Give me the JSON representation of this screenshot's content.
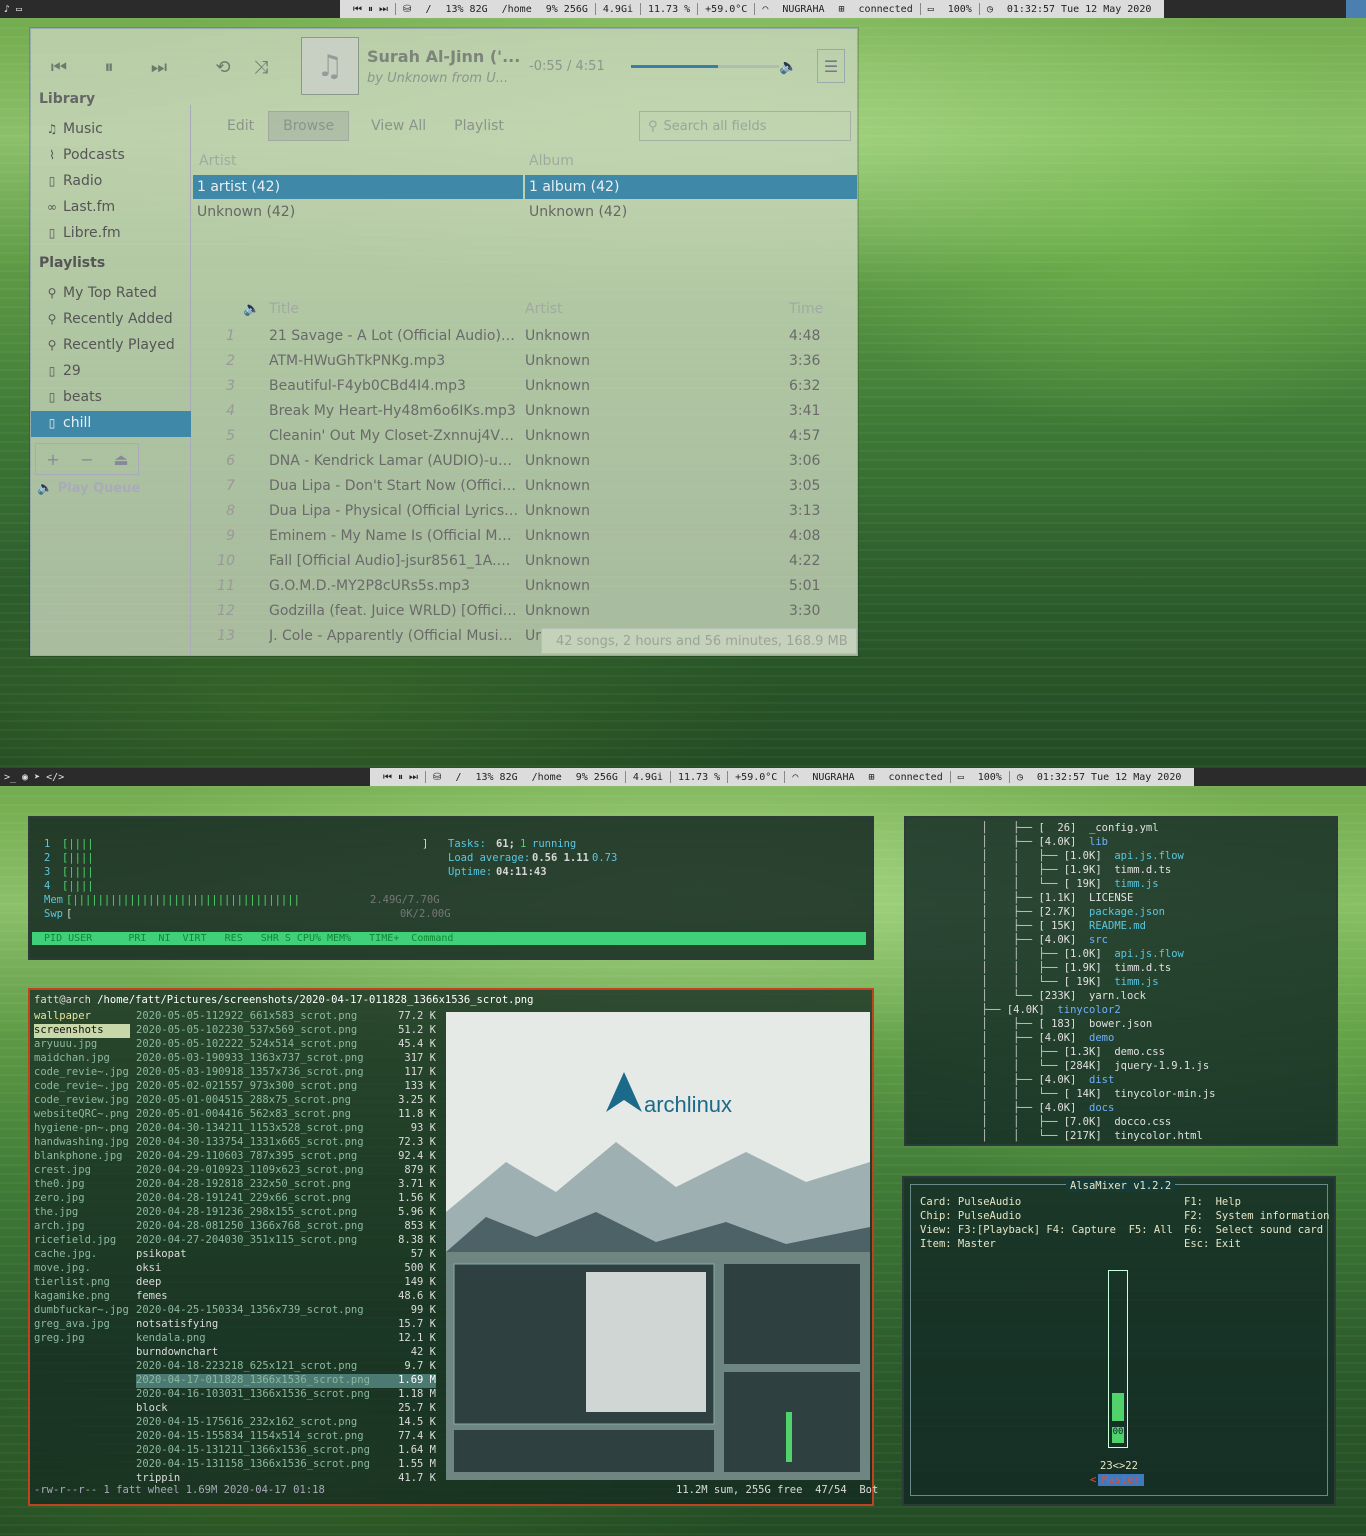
{
  "topbar": {
    "media": "⏮ ⏸ ⏭",
    "disk_root_label": "/",
    "disk_root": "13% 82G",
    "disk_home_label": "/home",
    "disk_home": "9% 256G",
    "mem": "4.9Gi",
    "cpu": "11.73 %",
    "temp": "+59.0°C",
    "wifi": "NUGRAHA",
    "net": "connected",
    "battery": "100%",
    "clock": "01:32:57 Tue 12 May 2020"
  },
  "clementine": {
    "now_playing": {
      "title": "Surah Al-Jinn ('...",
      "subtitle": "by Unknown from U...",
      "time": "-0:55 / 4:51",
      "progress": 0.59
    },
    "sidebar": {
      "library_heading": "Library",
      "library": [
        {
          "label": "Music",
          "icon": "music-icon"
        },
        {
          "label": "Podcasts",
          "icon": "rss-icon"
        },
        {
          "label": "Radio",
          "icon": "radio-icon"
        },
        {
          "label": "Last.fm",
          "icon": "lastfm-icon"
        },
        {
          "label": "Libre.fm",
          "icon": "radio-icon"
        }
      ],
      "playlists_heading": "Playlists",
      "playlists": [
        {
          "label": "My Top Rated",
          "icon": "search-icon"
        },
        {
          "label": "Recently Added",
          "icon": "search-icon"
        },
        {
          "label": "Recently Played",
          "icon": "search-icon"
        },
        {
          "label": "29",
          "icon": "file-icon"
        },
        {
          "label": "beats",
          "icon": "file-icon"
        },
        {
          "label": "chill",
          "icon": "file-icon"
        }
      ],
      "tools": [
        "+",
        "−",
        "⏏"
      ],
      "play_queue": "Play Queue"
    },
    "tabs": [
      "Edit",
      "Browse",
      "View All",
      "Playlist"
    ],
    "search_placeholder": "Search all fields",
    "artist_col": "Artist",
    "album_col": "Album",
    "artists": [
      "1 artist (42)",
      "Unknown (42)"
    ],
    "albums": [
      "1 album (42)",
      "Unknown (42)"
    ],
    "track_headers": {
      "title": "Title",
      "artist": "Artist",
      "time": "Time"
    },
    "tracks": [
      {
        "n": "1",
        "title": "21 Savage - A Lot (Official Audio)-Vb...",
        "artist": "Unknown",
        "time": "4:48"
      },
      {
        "n": "2",
        "title": "ATM-HWuGhTkPNKg.mp3",
        "artist": "Unknown",
        "time": "3:36"
      },
      {
        "n": "3",
        "title": "Beautiful-F4yb0CBd4I4.mp3",
        "artist": "Unknown",
        "time": "6:32"
      },
      {
        "n": "4",
        "title": "Break My Heart-Hy48m6o6IKs.mp3",
        "artist": "Unknown",
        "time": "3:41"
      },
      {
        "n": "5",
        "title": "Cleanin' Out My Closet-Zxnnuj4Vp_...",
        "artist": "Unknown",
        "time": "4:57"
      },
      {
        "n": "6",
        "title": "DNA - Kendrick Lamar (AUDIO)-uX6...",
        "artist": "Unknown",
        "time": "3:06"
      },
      {
        "n": "7",
        "title": "Dua Lipa - Don't Start Now (Official ...",
        "artist": "Unknown",
        "time": "3:05"
      },
      {
        "n": "8",
        "title": "Dua Lipa - Physical (Official Lyrics V...",
        "artist": "Unknown",
        "time": "3:13"
      },
      {
        "n": "9",
        "title": "Eminem - My Name Is (Official Mus...",
        "artist": "Unknown",
        "time": "4:08"
      },
      {
        "n": "10",
        "title": "Fall [Official Audio]-jsur8561_1A.mp3",
        "artist": "Unknown",
        "time": "4:22"
      },
      {
        "n": "11",
        "title": "G.O.M.D.-MY2P8cURs5s.mp3",
        "artist": "Unknown",
        "time": "5:01"
      },
      {
        "n": "12",
        "title": "Godzilla (feat. Juice WRLD) [Official ...",
        "artist": "Unknown",
        "time": "3:30"
      },
      {
        "n": "13",
        "title": "J. Cole - Apparently (Official Music ...",
        "artist": "Ur",
        "time": ""
      }
    ],
    "status": "42 songs, 2 hours and 56 minutes, 168.9 MB"
  },
  "htop": {
    "cpus": [
      "1",
      "2",
      "3",
      "4"
    ],
    "mem_label": "Mem",
    "swp_label": "Swp",
    "mem_value": "2.49G/7.70G",
    "swp_value": "0K/2.00G",
    "tasks_label": "Tasks:",
    "tasks": "61;",
    "running_count": "1",
    "running": "running",
    "load_label": "Load average:",
    "load": "0.56 1.11",
    "load15": "0.73",
    "uptime_label": "Uptime:",
    "uptime": "04:11:43",
    "header": "  PID USER      PRI  NI  VIRT   RES   SHR S CPU% MEM%   TIME+  Command"
  },
  "ranger": {
    "path_user": "fatt@arch",
    "path": "/home/fatt/Pictures/screenshots/2020-04-17-011828_1366x1536_scrot.png",
    "parent": [
      "wallpaper",
      "screenshots",
      "aryuuu.jpg",
      "maidchan.jpg",
      "code_revie~.jpg",
      "code_revie~.jpg",
      "code_review.jpg",
      "websiteQRC~.png",
      "hygiene-pn~.png",
      "handwashing.jpg",
      "blankphone.jpg",
      "crest.jpg",
      "the0.jpg",
      "zero.jpg",
      "the.jpg",
      "arch.jpg",
      "ricefield.jpg",
      "cache.jpg.",
      "move.jpg.",
      "tierlist.png",
      "kagamike.png",
      "dumbfuckar~.jpg",
      "greg_ava.jpg",
      "greg.jpg"
    ],
    "files": [
      {
        "name": "2020-05-05-112922_661x583_scrot.png",
        "size": "77.2 K"
      },
      {
        "name": "2020-05-05-102230_537x569_scrot.png",
        "size": "51.2 K"
      },
      {
        "name": "2020-05-05-102222_524x514_scrot.png",
        "size": "45.4 K"
      },
      {
        "name": "2020-05-03-190933_1363x737_scrot.png",
        "size": "317 K"
      },
      {
        "name": "2020-05-03-190918_1357x736_scrot.png",
        "size": "117 K"
      },
      {
        "name": "2020-05-02-021557_973x300_scrot.png",
        "size": "133 K"
      },
      {
        "name": "2020-05-01-004515_288x75_scrot.png",
        "size": "3.25 K"
      },
      {
        "name": "2020-05-01-004416_562x83_scrot.png",
        "size": "11.8 K"
      },
      {
        "name": "2020-04-30-134211_1153x528_scrot.png",
        "size": "93 K"
      },
      {
        "name": "2020-04-30-133754_1331x665_scrot.png",
        "size": "72.3 K"
      },
      {
        "name": "2020-04-29-110603_787x395_scrot.png",
        "size": "92.4 K"
      },
      {
        "name": "2020-04-29-010923_1109x623_scrot.png",
        "size": "879 K"
      },
      {
        "name": "2020-04-28-192818_232x50_scrot.png",
        "size": "3.71 K"
      },
      {
        "name": "2020-04-28-191241_229x66_scrot.png",
        "size": "1.56 K"
      },
      {
        "name": "2020-04-28-191236_298x155_scrot.png",
        "size": "5.96 K"
      },
      {
        "name": "2020-04-28-081250_1366x768_scrot.png",
        "size": "853 K"
      },
      {
        "name": "2020-04-27-204030_351x115_scrot.png",
        "size": "8.38 K"
      },
      {
        "name": "psikopat",
        "size": "57 K"
      },
      {
        "name": "oksi",
        "size": "500 K"
      },
      {
        "name": "deep",
        "size": "149 K"
      },
      {
        "name": "femes",
        "size": "48.6 K"
      },
      {
        "name": "2020-04-25-150334_1356x739_scrot.png",
        "size": "99 K"
      },
      {
        "name": "notsatisfying",
        "size": "15.7 K"
      },
      {
        "name": "kendala.png",
        "size": "12.1 K"
      },
      {
        "name": "burndownchart",
        "size": "42 K"
      },
      {
        "name": "2020-04-18-223218_625x121_scrot.png",
        "size": "9.7 K"
      },
      {
        "name": "2020-04-17-011828_1366x1536_scrot.png",
        "size": "1.69 M"
      },
      {
        "name": "2020-04-16-103031_1366x1536_scrot.png",
        "size": "1.18 M"
      },
      {
        "name": "block",
        "size": "25.7 K"
      },
      {
        "name": "2020-04-15-175616_232x162_scrot.png",
        "size": "14.5 K"
      },
      {
        "name": "2020-04-15-155834_1154x514_scrot.png",
        "size": "77.4 K"
      },
      {
        "name": "2020-04-15-131211_1366x1536_scrot.png",
        "size": "1.64 M"
      },
      {
        "name": "2020-04-15-131158_1366x1536_scrot.png",
        "size": "1.55 M"
      },
      {
        "name": "trippin",
        "size": "41.7 K"
      }
    ],
    "statusbar": "-rw-r--r-- 1 fatt wheel 1.69M 2020-04-17 01:18",
    "status_right": "11.2M sum, 255G free  47/54  Bot",
    "preview_logo": "archlinux"
  },
  "tree": [
    {
      "indent": "│    ├── ",
      "size": "[  26]",
      "name": "_config.yml",
      "c": ""
    },
    {
      "indent": "│    ├── ",
      "size": "[4.0K]",
      "name": "lib",
      "c": "blue"
    },
    {
      "indent": "│    │   ├── ",
      "size": "[1.0K]",
      "name": "api.js.flow",
      "c": "cyan"
    },
    {
      "indent": "│    │   ├── ",
      "size": "[1.9K]",
      "name": "timm.d.ts",
      "c": ""
    },
    {
      "indent": "│    │   └── ",
      "size": "[ 19K]",
      "name": "timm.js",
      "c": "cyan"
    },
    {
      "indent": "│    ├── ",
      "size": "[1.1K]",
      "name": "LICENSE",
      "c": ""
    },
    {
      "indent": "│    ├── ",
      "size": "[2.7K]",
      "name": "package.json",
      "c": "cyan"
    },
    {
      "indent": "│    ├── ",
      "size": "[ 15K]",
      "name": "README.md",
      "c": "cyan"
    },
    {
      "indent": "│    ├── ",
      "size": "[4.0K]",
      "name": "src",
      "c": "blue"
    },
    {
      "indent": "│    │   ├── ",
      "size": "[1.0K]",
      "name": "api.js.flow",
      "c": "cyan"
    },
    {
      "indent": "│    │   ├── ",
      "size": "[1.9K]",
      "name": "timm.d.ts",
      "c": ""
    },
    {
      "indent": "│    │   └── ",
      "size": "[ 19K]",
      "name": "timm.js",
      "c": "cyan"
    },
    {
      "indent": "│    └── ",
      "size": "[233K]",
      "name": "yarn.lock",
      "c": ""
    },
    {
      "indent": "├── ",
      "size": "[4.0K]",
      "name": "tinycolor2",
      "c": "blue"
    },
    {
      "indent": "│    ├── ",
      "size": "[ 183]",
      "name": "bower.json",
      "c": ""
    },
    {
      "indent": "│    ├── ",
      "size": "[4.0K]",
      "name": "demo",
      "c": "blue"
    },
    {
      "indent": "│    │   ├── ",
      "size": "[1.3K]",
      "name": "demo.css",
      "c": ""
    },
    {
      "indent": "│    │   └── ",
      "size": "[284K]",
      "name": "jquery-1.9.1.js",
      "c": ""
    },
    {
      "indent": "│    ├── ",
      "size": "[4.0K]",
      "name": "dist",
      "c": "blue"
    },
    {
      "indent": "│    │   └── ",
      "size": "[ 14K]",
      "name": "tinycolor-min.js",
      "c": ""
    },
    {
      "indent": "│    ├── ",
      "size": "[4.0K]",
      "name": "docs",
      "c": "blue"
    },
    {
      "indent": "│    │   ├── ",
      "size": "[7.0K]",
      "name": "docco.css",
      "c": ""
    },
    {
      "indent": "│    │   └── ",
      "size": "[217K]",
      "name": "tinycolor.html",
      "c": ""
    }
  ],
  "alsa": {
    "title": "AlsaMixer v1.2.2",
    "card": "Card: PulseAudio",
    "chip": "Chip: PulseAudio",
    "view": "View: F3:[Playback] F4: Capture  F5: All",
    "item": "Item: Master",
    "help": [
      "F1:  Help",
      "F2:  System information",
      "F6:  Select sound card",
      "Esc: Exit"
    ],
    "level": "00",
    "vol": "23<>22",
    "channel": "Master",
    "fill": 0.2
  }
}
